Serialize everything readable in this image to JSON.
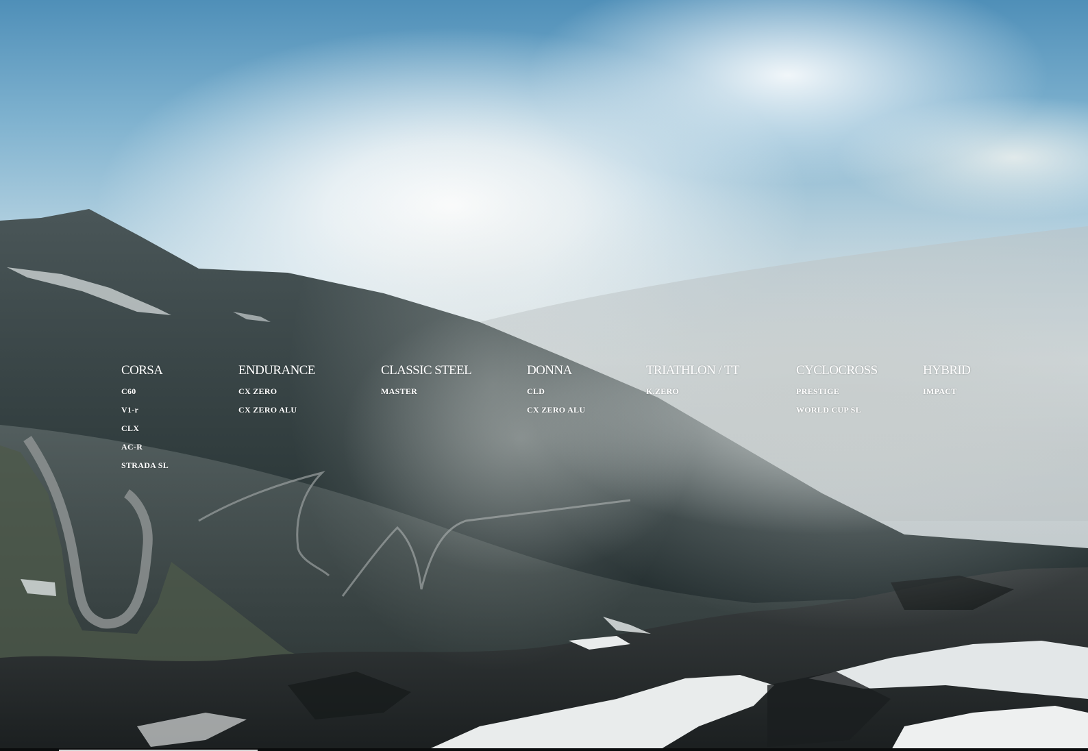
{
  "background": {
    "scene": "alpine-pass-photo",
    "sky_color": "#5a97bf",
    "mountain_color": "#2f3a3b",
    "snow_color": "#e9ecec"
  },
  "menu": {
    "categories": [
      {
        "title": "CORSA",
        "items": [
          "C60",
          "V1-r",
          "CLX",
          "AC-R",
          "STRADA SL"
        ]
      },
      {
        "title": "ENDURANCE",
        "items": [
          "CX ZERO",
          "CX ZERO ALU"
        ]
      },
      {
        "title": "CLASSIC STEEL",
        "items": [
          "MASTER"
        ]
      },
      {
        "title": "DONNA",
        "items": [
          "CLD",
          "CX ZERO ALU"
        ]
      },
      {
        "title": "TRIATHLON / TT",
        "items": [
          "K.ZERO"
        ]
      },
      {
        "title": "CYCLOCROSS",
        "items": [
          "PRESTIGE",
          "WORLD CUP SL"
        ]
      },
      {
        "title": "HYBRID",
        "items": [
          "IMPACT"
        ]
      }
    ],
    "text_color": "#ffffff"
  }
}
